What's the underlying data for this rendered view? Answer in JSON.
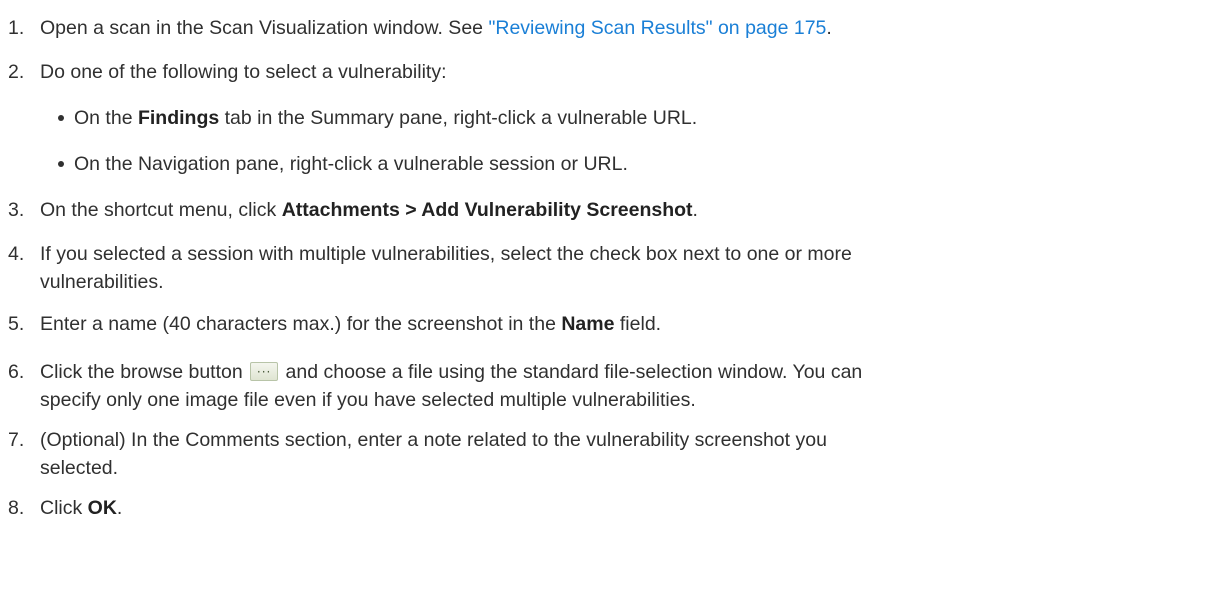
{
  "steps": [
    {
      "num": "1.",
      "text": "Open a scan in the Scan Visualization window. See ",
      "link": "\"Reviewing Scan Results\" on page 175",
      "after": "."
    },
    {
      "num": "2.",
      "text": "Do one of the following to select a vulnerability:"
    },
    {
      "num": "3.",
      "pre": "On the shortcut menu, click ",
      "bold": "Attachments > Add Vulnerability Screenshot",
      "post": "."
    },
    {
      "num": "4.",
      "line1": "If you selected a session with multiple vulnerabilities, select the check box next to one or more",
      "line2": "vulnerabilities."
    },
    {
      "num": "5.",
      "pre": "Enter a name (40 characters max.) for the screenshot in the ",
      "bold": "Name",
      "post": " field."
    },
    {
      "num": "6.",
      "pre": "Click the browse button ",
      "post": " and choose a file using the standard file-selection window. You can",
      "line2": "specify only one image file even if you have selected multiple vulnerabilities."
    },
    {
      "num": "7.",
      "line1": "(Optional) In the Comments section, enter a note related to the vulnerability screenshot you",
      "line2": "selected."
    },
    {
      "num": "8.",
      "pre": "Click ",
      "bold": "OK",
      "post": "."
    }
  ],
  "bullets": [
    {
      "pre": "On the ",
      "bold": "Findings",
      "post": " tab in the Summary pane, right-click a vulnerable URL."
    },
    {
      "text": "On the Navigation pane, right-click a vulnerable session or URL."
    }
  ],
  "browse_button": {
    "icon": "ellipsis-icon",
    "glyph": "···"
  },
  "colors": {
    "text": "#303030",
    "link": "#1a7fd6"
  }
}
